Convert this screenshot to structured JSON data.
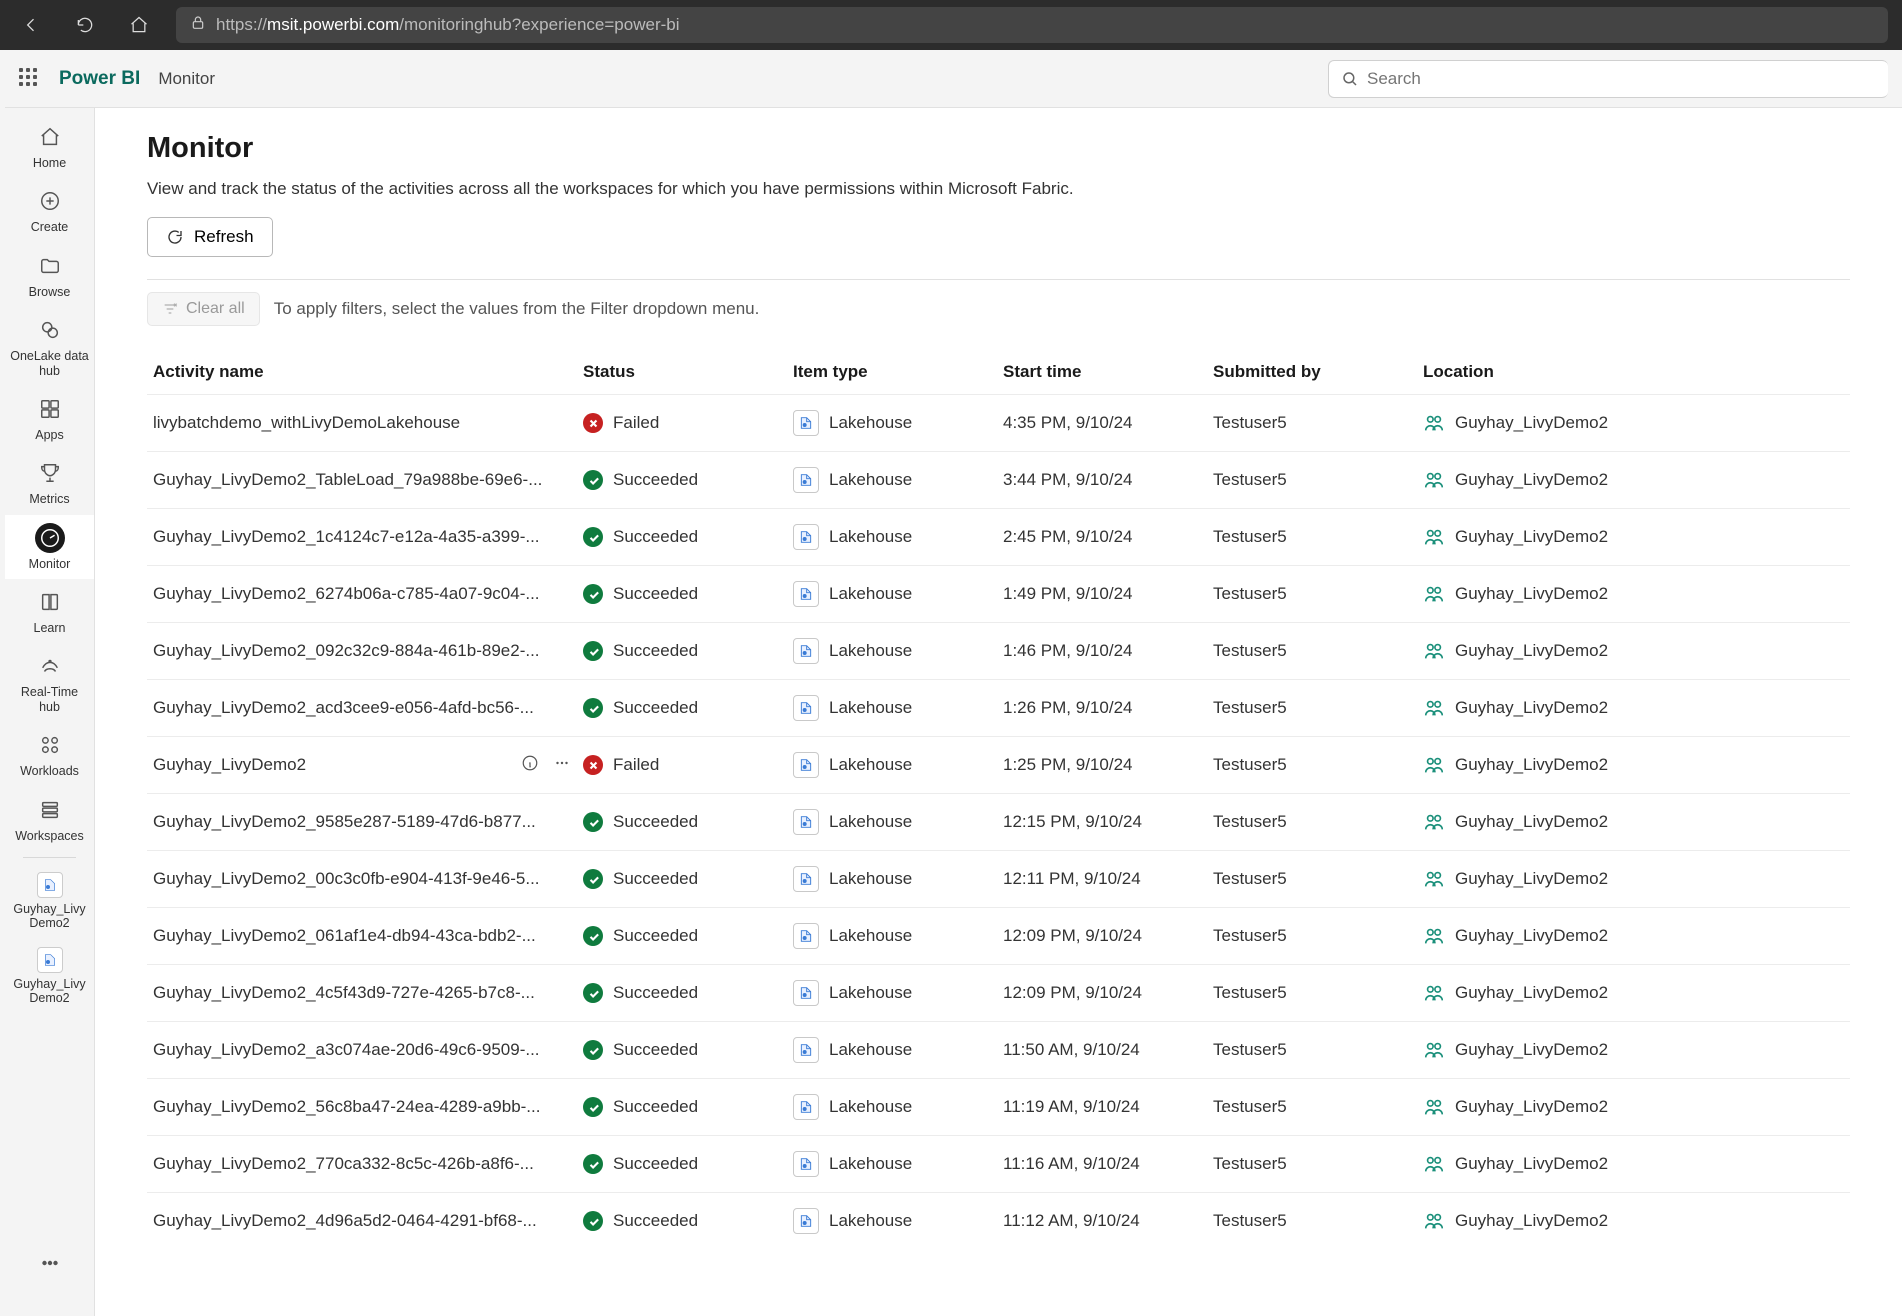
{
  "browser": {
    "url_display_prefix": "https://",
    "url_host": "msit.powerbi.com",
    "url_path": "/monitoringhub?experience=power-bi"
  },
  "header": {
    "brand": "Power BI",
    "breadcrumb": "Monitor",
    "search_placeholder": "Search"
  },
  "rail": [
    {
      "key": "home",
      "label": "Home"
    },
    {
      "key": "create",
      "label": "Create"
    },
    {
      "key": "browse",
      "label": "Browse"
    },
    {
      "key": "onelake",
      "label": "OneLake data hub"
    },
    {
      "key": "apps",
      "label": "Apps"
    },
    {
      "key": "metrics",
      "label": "Metrics"
    },
    {
      "key": "monitor",
      "label": "Monitor",
      "active": true
    },
    {
      "key": "learn",
      "label": "Learn"
    },
    {
      "key": "realtime",
      "label": "Real-Time hub"
    },
    {
      "key": "workloads",
      "label": "Workloads"
    },
    {
      "key": "workspaces",
      "label": "Workspaces"
    }
  ],
  "rail_recent": [
    {
      "label": "Guyhay_Livy Demo2"
    },
    {
      "label": "Guyhay_Livy Demo2"
    }
  ],
  "page": {
    "title": "Monitor",
    "subtitle": "View and track the status of the activities across all the workspaces for which you have permissions within Microsoft Fabric.",
    "refresh_label": "Refresh",
    "clear_label": "Clear all",
    "filter_hint": "To apply filters, select the values from the Filter dropdown menu."
  },
  "columns": {
    "activity": "Activity name",
    "status": "Status",
    "item_type": "Item type",
    "start_time": "Start time",
    "submitted_by": "Submitted by",
    "location": "Location"
  },
  "status_labels": {
    "Succeeded": "Succeeded",
    "Failed": "Failed"
  },
  "rows": [
    {
      "activity": "livybatchdemo_withLivyDemoLakehouse",
      "status": "Failed",
      "item_type": "Lakehouse",
      "start_time": "4:35 PM, 9/10/24",
      "submitted_by": "Testuser5",
      "location": "Guyhay_LivyDemo2",
      "hover": false
    },
    {
      "activity": "Guyhay_LivyDemo2_TableLoad_79a988be-69e6-...",
      "status": "Succeeded",
      "item_type": "Lakehouse",
      "start_time": "3:44 PM, 9/10/24",
      "submitted_by": "Testuser5",
      "location": "Guyhay_LivyDemo2",
      "hover": false
    },
    {
      "activity": "Guyhay_LivyDemo2_1c4124c7-e12a-4a35-a399-...",
      "status": "Succeeded",
      "item_type": "Lakehouse",
      "start_time": "2:45 PM, 9/10/24",
      "submitted_by": "Testuser5",
      "location": "Guyhay_LivyDemo2",
      "hover": false
    },
    {
      "activity": "Guyhay_LivyDemo2_6274b06a-c785-4a07-9c04-...",
      "status": "Succeeded",
      "item_type": "Lakehouse",
      "start_time": "1:49 PM, 9/10/24",
      "submitted_by": "Testuser5",
      "location": "Guyhay_LivyDemo2",
      "hover": false
    },
    {
      "activity": "Guyhay_LivyDemo2_092c32c9-884a-461b-89e2-...",
      "status": "Succeeded",
      "item_type": "Lakehouse",
      "start_time": "1:46 PM, 9/10/24",
      "submitted_by": "Testuser5",
      "location": "Guyhay_LivyDemo2",
      "hover": false
    },
    {
      "activity": "Guyhay_LivyDemo2_acd3cee9-e056-4afd-bc56-...",
      "status": "Succeeded",
      "item_type": "Lakehouse",
      "start_time": "1:26 PM, 9/10/24",
      "submitted_by": "Testuser5",
      "location": "Guyhay_LivyDemo2",
      "hover": false
    },
    {
      "activity": "Guyhay_LivyDemo2",
      "status": "Failed",
      "item_type": "Lakehouse",
      "start_time": "1:25 PM, 9/10/24",
      "submitted_by": "Testuser5",
      "location": "Guyhay_LivyDemo2",
      "hover": true
    },
    {
      "activity": "Guyhay_LivyDemo2_9585e287-5189-47d6-b877...",
      "status": "Succeeded",
      "item_type": "Lakehouse",
      "start_time": "12:15 PM, 9/10/24",
      "submitted_by": "Testuser5",
      "location": "Guyhay_LivyDemo2",
      "hover": false
    },
    {
      "activity": "Guyhay_LivyDemo2_00c3c0fb-e904-413f-9e46-5...",
      "status": "Succeeded",
      "item_type": "Lakehouse",
      "start_time": "12:11 PM, 9/10/24",
      "submitted_by": "Testuser5",
      "location": "Guyhay_LivyDemo2",
      "hover": false
    },
    {
      "activity": "Guyhay_LivyDemo2_061af1e4-db94-43ca-bdb2-...",
      "status": "Succeeded",
      "item_type": "Lakehouse",
      "start_time": "12:09 PM, 9/10/24",
      "submitted_by": "Testuser5",
      "location": "Guyhay_LivyDemo2",
      "hover": false
    },
    {
      "activity": "Guyhay_LivyDemo2_4c5f43d9-727e-4265-b7c8-...",
      "status": "Succeeded",
      "item_type": "Lakehouse",
      "start_time": "12:09 PM, 9/10/24",
      "submitted_by": "Testuser5",
      "location": "Guyhay_LivyDemo2",
      "hover": false
    },
    {
      "activity": "Guyhay_LivyDemo2_a3c074ae-20d6-49c6-9509-...",
      "status": "Succeeded",
      "item_type": "Lakehouse",
      "start_time": "11:50 AM, 9/10/24",
      "submitted_by": "Testuser5",
      "location": "Guyhay_LivyDemo2",
      "hover": false
    },
    {
      "activity": "Guyhay_LivyDemo2_56c8ba47-24ea-4289-a9bb-...",
      "status": "Succeeded",
      "item_type": "Lakehouse",
      "start_time": "11:19 AM, 9/10/24",
      "submitted_by": "Testuser5",
      "location": "Guyhay_LivyDemo2",
      "hover": false
    },
    {
      "activity": "Guyhay_LivyDemo2_770ca332-8c5c-426b-a8f6-...",
      "status": "Succeeded",
      "item_type": "Lakehouse",
      "start_time": "11:16 AM, 9/10/24",
      "submitted_by": "Testuser5",
      "location": "Guyhay_LivyDemo2",
      "hover": false
    },
    {
      "activity": "Guyhay_LivyDemo2_4d96a5d2-0464-4291-bf68-...",
      "status": "Succeeded",
      "item_type": "Lakehouse",
      "start_time": "11:12 AM, 9/10/24",
      "submitted_by": "Testuser5",
      "location": "Guyhay_LivyDemo2",
      "hover": false
    }
  ]
}
